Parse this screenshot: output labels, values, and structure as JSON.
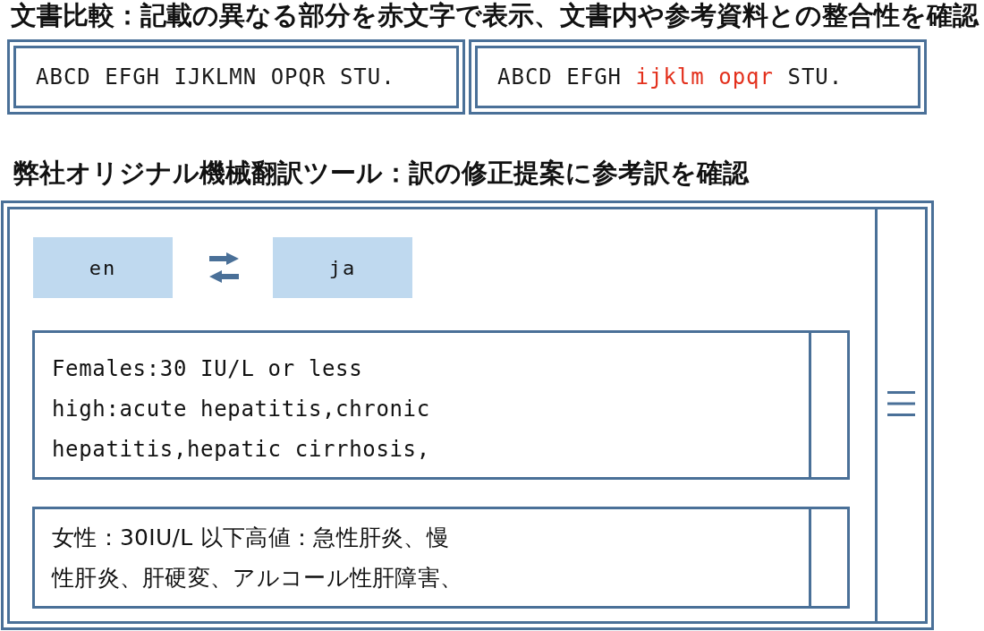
{
  "comparison": {
    "heading": "文書比較：記載の異なる部分を赤文字で表示、文書内や参考資料との整合性を確認",
    "documents": [
      {
        "segments": [
          {
            "text": "ABCD EFGH IJKLMN OPQR STU.",
            "changed": false
          }
        ]
      },
      {
        "segments": [
          {
            "text": "ABCD EFGH",
            "changed": false
          },
          {
            "text": "ijklm opqr",
            "changed": true
          },
          {
            "text": "STU.",
            "changed": false
          }
        ]
      }
    ]
  },
  "translator": {
    "heading": "弊社オリジナル機械翻訳ツール：訳の修正提案に参考訳を確認",
    "source_language": "en",
    "target_language": "ja",
    "source_text": "Females:30 IU/L or less\nhigh:acute hepatitis,chronic\nhepatitis,hepatic cirrhosis,",
    "translation": "女性：30IU/L 以下高値：急性肝炎、慢性肝炎、肝硬変、アルコール性肝障害、"
  }
}
